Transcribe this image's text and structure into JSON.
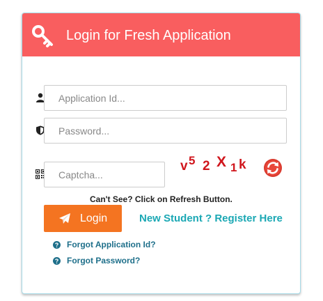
{
  "header": {
    "title": "Login for Fresh Application",
    "icon": "key-icon",
    "background_color": "#f95e5f"
  },
  "form": {
    "application_id": {
      "placeholder": "Application Id...",
      "value": "",
      "icon": "user-icon"
    },
    "password": {
      "placeholder": "Password...",
      "value": "",
      "icon": "shield-icon"
    },
    "captcha": {
      "placeholder": "Captcha...",
      "value": "",
      "icon": "qr-code-icon",
      "image_text": [
        "v",
        "5",
        "2",
        "X",
        "1",
        "k"
      ],
      "refresh_icon": "refresh-icon"
    },
    "hint": "Can't See? Click on Refresh Button.",
    "login_label": "Login",
    "login_icon": "paper-plane-icon",
    "login_color": "#f47421",
    "register_label": "New Student ? Register Here",
    "forgot_application_id": "Forgot Application Id?",
    "forgot_password": "Forgot Password?",
    "forgot_icon": "question-circle-icon"
  }
}
